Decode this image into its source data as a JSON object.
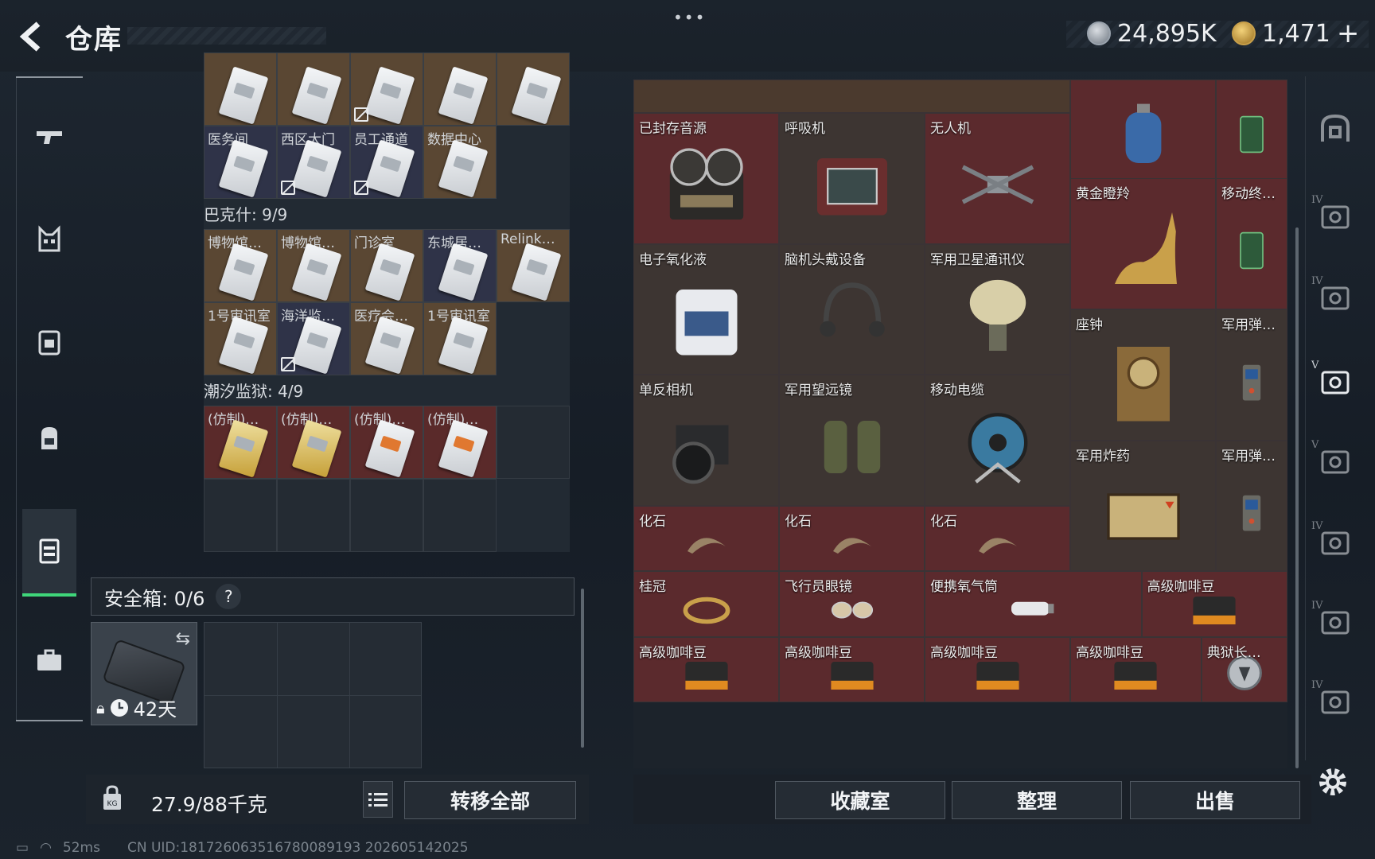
{
  "header": {
    "title": "仓库",
    "menu_dots": "•••"
  },
  "currency": {
    "silver_amount": "24,895K",
    "gold_amount": "1,471",
    "plus": "+",
    "silver_icon": "silver-coin-icon",
    "gold_icon": "gold-coin-icon"
  },
  "left_rail": {
    "items": [
      "gun-icon",
      "armor-icon",
      "vest-icon",
      "backpack-icon",
      "container-icon",
      "briefcase-icon"
    ],
    "active_index": 4,
    "accent": "#3fd67a"
  },
  "keys": {
    "top_row": [
      "",
      "",
      "",
      "",
      ""
    ],
    "row_a": [
      {
        "label": "医务间",
        "color": "blue"
      },
      {
        "label": "西区大门",
        "color": "blue"
      },
      {
        "label": "员工通道",
        "color": "blue"
      },
      {
        "label": "数据中心",
        "color": "tan"
      }
    ],
    "bakshi": {
      "label": "巴克什: 9/9"
    },
    "row_b": [
      {
        "label": "博物馆…"
      },
      {
        "label": "博物馆…"
      },
      {
        "label": "门诊室"
      },
      {
        "label": "东城居…"
      },
      {
        "label": "Relink…"
      }
    ],
    "row_c": [
      {
        "label": "1号审讯室"
      },
      {
        "label": "海洋监…"
      },
      {
        "label": "医疗会…"
      },
      {
        "label": "1号审讯室"
      }
    ],
    "tide": {
      "label": "潮汐监狱: 4/9"
    },
    "row_d": [
      {
        "label": "(仿制)…"
      },
      {
        "label": "(仿制)…"
      },
      {
        "label": "(仿制)…"
      },
      {
        "label": "(仿制)…"
      }
    ]
  },
  "safe_box": {
    "label": "安全箱:  0/6",
    "help": "?",
    "days": "42天"
  },
  "capacity": {
    "weight": "27.9/88千克"
  },
  "buttons": {
    "transfer_all": "转移全部",
    "collection": "收藏室",
    "organize": "整理",
    "sell": "出售"
  },
  "status": {
    "ping": "52ms",
    "uid": "CN UID:1817260635167800891​93 202605142025"
  },
  "stash": {
    "items": [
      {
        "label": "已封存音源",
        "icon": "tape-recorder-icon"
      },
      {
        "label": "呼吸机",
        "icon": "ventilator-icon"
      },
      {
        "label": "无人机",
        "icon": "drone-icon"
      },
      {
        "label": "黄金瞪羚",
        "icon": "gold-gazelle-icon"
      },
      {
        "label": "移动终…",
        "icon": "mobile-terminal-icon"
      },
      {
        "label": "电子氧化液",
        "icon": "chemical-jug-icon"
      },
      {
        "label": "脑机头戴设备",
        "icon": "headset-icon"
      },
      {
        "label": "军用卫星通讯仪",
        "icon": "satellite-dish-icon"
      },
      {
        "label": "座钟",
        "icon": "clock-icon"
      },
      {
        "label": "军用弹…",
        "icon": "radio-icon"
      },
      {
        "label": "单反相机",
        "icon": "camera-icon"
      },
      {
        "label": "军用望远镜",
        "icon": "binoculars-icon"
      },
      {
        "label": "移动电缆",
        "icon": "cable-reel-icon"
      },
      {
        "label": "军用炸药",
        "icon": "explosive-crate-icon"
      },
      {
        "label": "军用弹…",
        "icon": "radio-icon"
      },
      {
        "label": "化石",
        "icon": "fossil-claw-icon"
      },
      {
        "label": "化石",
        "icon": "fossil-claw-icon"
      },
      {
        "label": "化石",
        "icon": "fossil-claw-icon"
      },
      {
        "label": "桂冠",
        "icon": "laurel-icon"
      },
      {
        "label": "飞行员眼镜",
        "icon": "aviator-glasses-icon"
      },
      {
        "label": "便携氧气筒",
        "icon": "oxygen-tank-icon"
      },
      {
        "label": "高级咖啡豆",
        "icon": "coffee-bag-icon"
      },
      {
        "label": "高级咖啡豆",
        "icon": "coffee-bag-icon"
      },
      {
        "label": "高级咖啡豆",
        "icon": "coffee-bag-icon"
      },
      {
        "label": "高级咖啡豆",
        "icon": "coffee-bag-icon"
      },
      {
        "label": "高级咖啡豆",
        "icon": "coffee-bag-icon"
      },
      {
        "label": "典狱长…",
        "icon": "badge-icon"
      }
    ]
  },
  "right_rail": {
    "items": [
      {
        "icon": "stash-home-icon",
        "tag": ""
      },
      {
        "icon": "folder-icon",
        "tag": "IV"
      },
      {
        "icon": "medkit-icon",
        "tag": "IV"
      },
      {
        "icon": "camera-case-icon",
        "tag": "V"
      },
      {
        "icon": "camera-case-icon",
        "tag": "V"
      },
      {
        "icon": "warning-case-icon",
        "tag": "IV"
      },
      {
        "icon": "warning-case-icon",
        "tag": "IV"
      },
      {
        "icon": "warning-case-icon",
        "tag": "IV"
      }
    ],
    "active_index": 3
  }
}
